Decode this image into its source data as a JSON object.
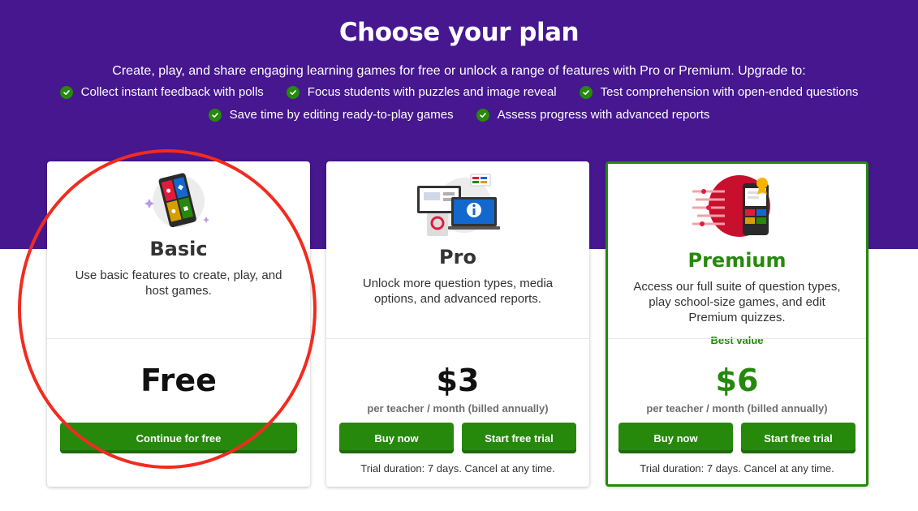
{
  "hero": {
    "title": "Choose your plan",
    "subtitle": "Create, play, and share engaging learning games for free or unlock a range of features with Pro or Premium. Upgrade to:",
    "features_row1": [
      "Collect instant feedback with polls",
      "Focus students with puzzles and image reveal",
      "Test comprehension with open-ended questions"
    ],
    "features_row2": [
      "Save time by editing ready-to-play games",
      "Assess progress with advanced reports"
    ],
    "icon": "check-circle-icon"
  },
  "plans": {
    "basic": {
      "name": "Basic",
      "description": "Use basic features to create, play, and host games.",
      "price": "Free",
      "cta": "Continue for free"
    },
    "pro": {
      "name": "Pro",
      "description": "Unlock more question types, media options, and advanced reports.",
      "price": "$3",
      "period": "per teacher / month (billed annually)",
      "buy": "Buy now",
      "trial": "Start free trial",
      "trial_note": "Trial duration: 7 days. Cancel at any time."
    },
    "premium": {
      "name": "Premium",
      "description": "Access our full suite of question types, play school-size games, and edit Premium quizzes.",
      "badge": "Best value",
      "price": "$6",
      "period": "per teacher / month (billed annually)",
      "buy": "Buy now",
      "trial": "Start free trial",
      "trial_note": "Trial duration: 7 days. Cancel at any time."
    }
  },
  "colors": {
    "hero_bg": "#46178f",
    "accent_green": "#26890c",
    "annotation_red": "#f22b1f"
  }
}
